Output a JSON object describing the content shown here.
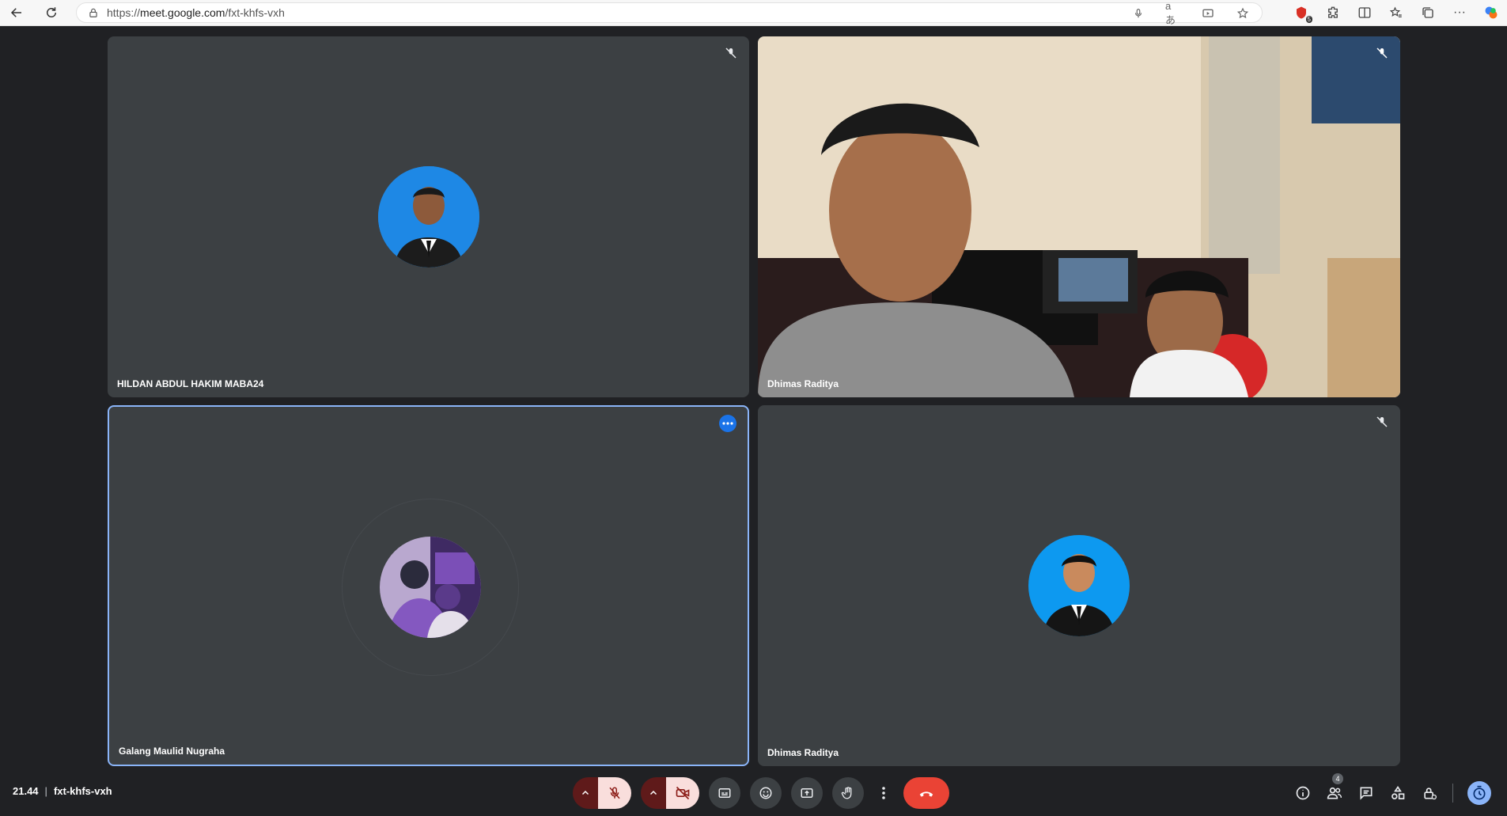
{
  "browser": {
    "url_scheme": "https://",
    "url_host": "meet.google.com",
    "url_path": "/fxt-khfs-vxh",
    "extension_badge": "5"
  },
  "tiles": [
    {
      "name": "HILDAN ABDUL HAKIM MABA24",
      "muted": true,
      "type": "avatar"
    },
    {
      "name": "Dhimas Raditya",
      "muted": true,
      "type": "video"
    },
    {
      "name": "Galang Maulid Nugraha",
      "muted": false,
      "type": "avatar",
      "selected": true
    },
    {
      "name": "Dhimas Raditya",
      "muted": true,
      "type": "avatar"
    }
  ],
  "footer": {
    "time": "21.44",
    "meeting_code": "fxt-khfs-vxh",
    "participants_count": "4"
  },
  "colors": {
    "background": "#202124",
    "tile": "#3c4043",
    "end_call": "#ea4335",
    "accent": "#8ab4f8"
  }
}
